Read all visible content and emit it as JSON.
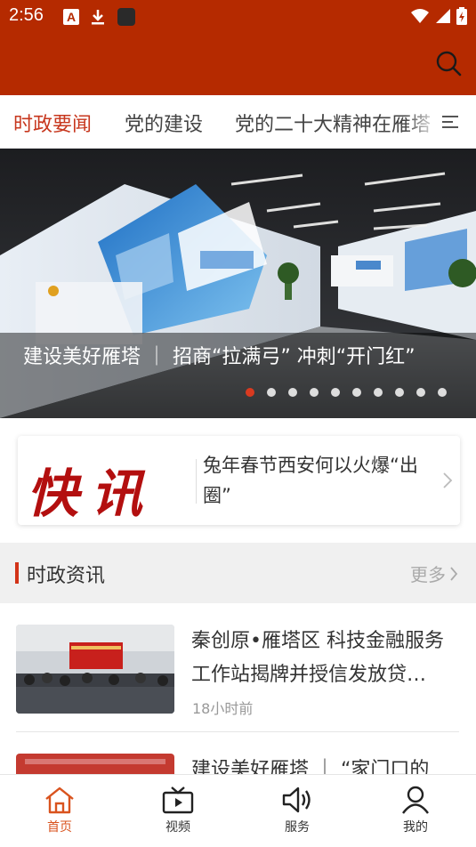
{
  "status_bar": {
    "time": "2:56"
  },
  "tabs": [
    {
      "label": "时政要闻",
      "active": true
    },
    {
      "label": "党的建设",
      "active": false
    },
    {
      "label": "党的二十大精神在雁塔",
      "active": false
    }
  ],
  "banner": {
    "caption": "建设美好雁塔 ｜ 招商“拉满弓” 冲刺“开门红”",
    "dot_count": 10,
    "active_dot": 0
  },
  "flash": {
    "logo_text": "快讯",
    "headline": "兔年春节西安何以火爆“出圈”"
  },
  "section": {
    "title": "时政资讯",
    "more": "更多"
  },
  "news": [
    {
      "title": "秦创原•雁塔区 科技金融服务工作站揭牌并授信发放贷…",
      "time": "18小时前"
    },
    {
      "title": "建设美好雁塔 ｜ “家门口的",
      "time": ""
    }
  ],
  "bottom_nav": [
    {
      "label": "首页",
      "icon": "home-icon",
      "active": true
    },
    {
      "label": "视频",
      "icon": "video-icon",
      "active": false
    },
    {
      "label": "服务",
      "icon": "speaker-icon",
      "active": false
    },
    {
      "label": "我的",
      "icon": "user-icon",
      "active": false
    }
  ],
  "colors": {
    "header": "#b52a00",
    "accent": "#c7371e",
    "nav_active": "#d9531e"
  }
}
